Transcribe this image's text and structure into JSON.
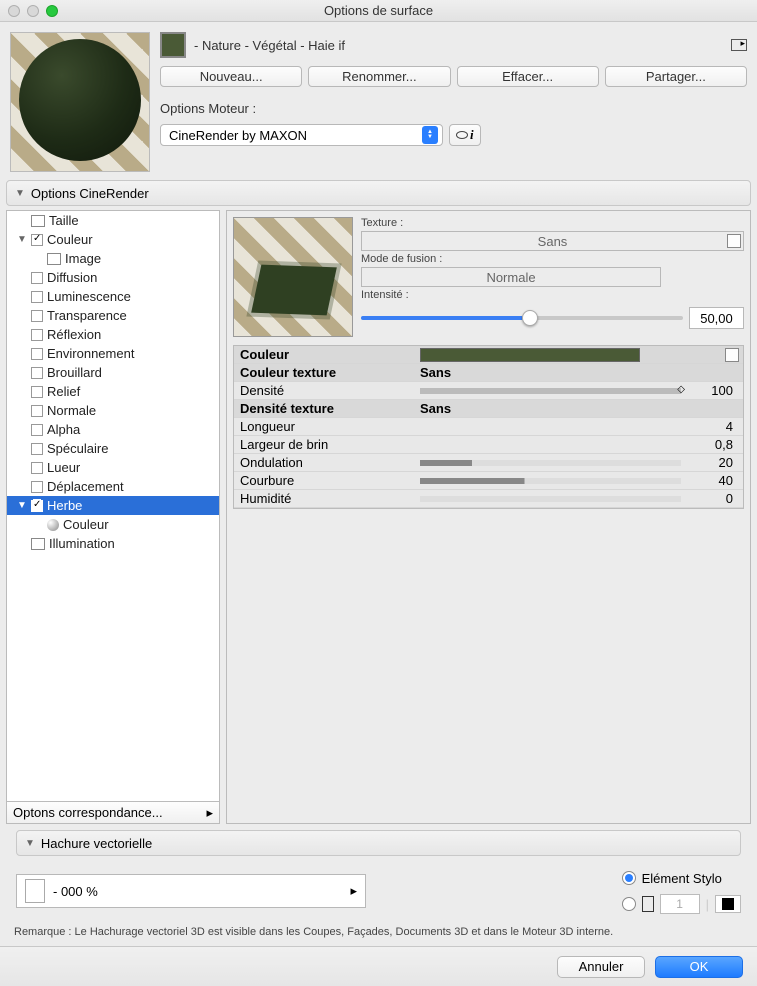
{
  "window": {
    "title": "Options de surface"
  },
  "material": {
    "name": " - Nature - Végétal - Haie if"
  },
  "buttons": {
    "new": "Nouveau...",
    "rename": "Renommer...",
    "delete": "Effacer...",
    "share": "Partager..."
  },
  "engine": {
    "label": "Options Moteur :",
    "value": "CineRender by MAXON"
  },
  "sections": {
    "cine": "Options CineRender",
    "hatch": "Hachure vectorielle"
  },
  "tree": {
    "size": "Taille",
    "color": "Couleur",
    "image": "Image",
    "diffusion": "Diffusion",
    "luminescence": "Luminescence",
    "transparency": "Transparence",
    "reflection": "Réflexion",
    "environment": "Environnement",
    "fog": "Brouillard",
    "relief": "Relief",
    "normal": "Normale",
    "alpha": "Alpha",
    "specular": "Spéculaire",
    "glow": "Lueur",
    "displacement": "Déplacement",
    "grass": "Herbe",
    "grass_color": "Couleur",
    "illumination": "Illumination",
    "footer": "Optons correspondance..."
  },
  "rp": {
    "texture": "Texture :",
    "texture_val": "Sans",
    "blend": "Mode de fusion :",
    "blend_val": "Normale",
    "intensity": "Intensité :",
    "intensity_val": "50,00"
  },
  "props": {
    "color": "Couleur",
    "tex_color": "Couleur texture",
    "tex_color_val": "Sans",
    "density": "Densité",
    "density_val": "100",
    "tex_density": "Densité texture",
    "tex_density_val": "Sans",
    "length": "Longueur",
    "length_val": "4",
    "blade_w": "Largeur de brin",
    "blade_w_val": "0,8",
    "wave": "Ondulation",
    "wave_val": "20",
    "curve": "Courbure",
    "curve_val": "40",
    "humidity": "Humidité",
    "humidity_val": "0"
  },
  "hatch": {
    "combo": " - 000 %",
    "opt1": "Elément Stylo",
    "num": "1"
  },
  "remark": "Remarque : Le Hachurage vectoriel 3D est visible dans les Coupes, Façades, Documents 3D et dans le Moteur 3D interne.",
  "footer": {
    "cancel": "Annuler",
    "ok": "OK"
  }
}
